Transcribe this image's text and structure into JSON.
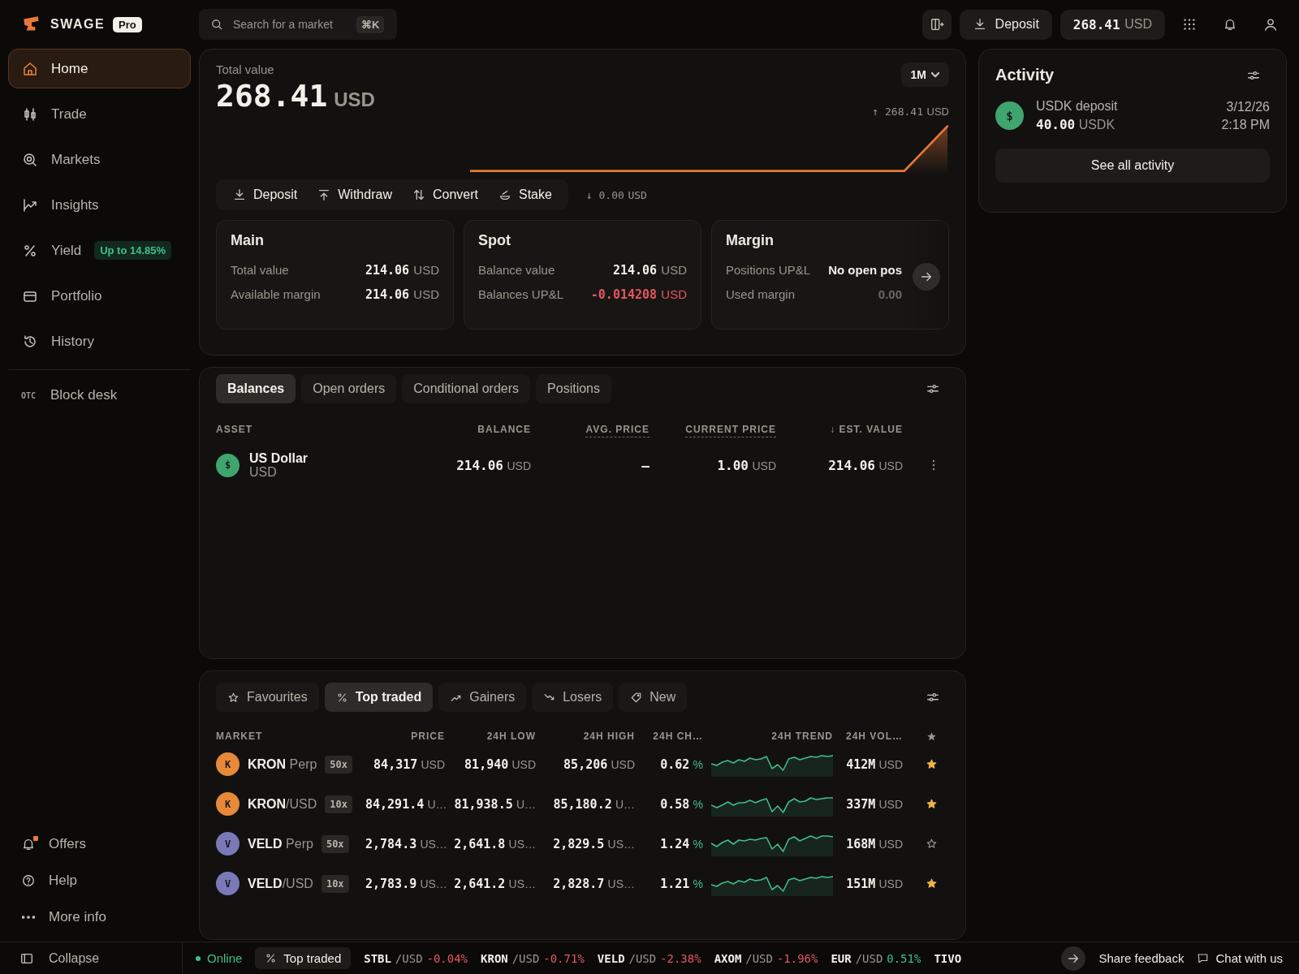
{
  "brand": {
    "name": "SWAGE",
    "badge": "Pro"
  },
  "sidebar": {
    "items": [
      {
        "label": "Home",
        "selected": true
      },
      {
        "label": "Trade",
        "selected": false
      },
      {
        "label": "Markets",
        "selected": false
      },
      {
        "label": "Insights",
        "selected": false
      },
      {
        "label": "Yield",
        "selected": false,
        "badge": "Up to 14.85%"
      },
      {
        "label": "Portfolio",
        "selected": false
      },
      {
        "label": "History",
        "selected": false
      }
    ],
    "otc": {
      "tag": "OTC",
      "label": "Block desk"
    },
    "bottom_items": [
      {
        "label": "Offers",
        "dot": true
      },
      {
        "label": "Help",
        "dot": false
      },
      {
        "label": "More info",
        "dot": false
      }
    ],
    "collapse": "Collapse"
  },
  "search": {
    "placeholder": "Search for a market",
    "shortcut": "⌘K"
  },
  "header": {
    "deposit": "Deposit",
    "balance": "268.41",
    "currency": "USD"
  },
  "overview": {
    "label": "Total value",
    "value": "268.41",
    "currency": "USD",
    "period": "1M",
    "high": "↑ 268.41",
    "high_currency": "USD",
    "low": "↓ 0.00",
    "low_currency": "USD",
    "actions": [
      "Deposit",
      "Withdraw",
      "Convert",
      "Stake"
    ],
    "accounts": [
      {
        "title": "Main",
        "rows": [
          {
            "label": "Total value",
            "value": "214.06",
            "unit": "USD",
            "negative": false
          },
          {
            "label": "Available margin",
            "value": "214.06",
            "unit": "USD",
            "negative": false
          }
        ]
      },
      {
        "title": "Spot",
        "rows": [
          {
            "label": "Balance value",
            "value": "214.06",
            "unit": "USD",
            "negative": false
          },
          {
            "label": "Balances UP&L",
            "value": "-0.014208",
            "unit": "USD",
            "negative": true
          }
        ]
      },
      {
        "title": "Margin",
        "rows": [
          {
            "label": "Positions UP&L",
            "value": "No open pos",
            "negative": false
          },
          {
            "label": "Used margin",
            "value": "0.00",
            "negative": false
          }
        ]
      }
    ]
  },
  "balances": {
    "tabs": [
      {
        "label": "Balances",
        "selected": true
      },
      {
        "label": "Open orders",
        "selected": false
      },
      {
        "label": "Conditional orders",
        "selected": false
      },
      {
        "label": "Positions",
        "selected": false
      }
    ],
    "columns": [
      "ASSET",
      "BALANCE",
      "AVG. PRICE",
      "CURRENT PRICE",
      "↓ EST. VALUE"
    ],
    "rows": [
      {
        "symbol": "$",
        "name": "US Dollar",
        "code": "USD",
        "balance": "214.06",
        "balance_unit": "USD",
        "avg_price": "–",
        "current_price": "1.00",
        "current_unit": "USD",
        "est_value": "214.06",
        "est_unit": "USD"
      }
    ]
  },
  "markets": {
    "tabs": [
      {
        "label": "Favourites",
        "selected": false
      },
      {
        "label": "Top traded",
        "selected": true
      },
      {
        "label": "Gainers",
        "selected": false
      },
      {
        "label": "Losers",
        "selected": false
      },
      {
        "label": "New",
        "selected": false
      }
    ],
    "columns": [
      "MARKET",
      "PRICE",
      "24H LOW",
      "24H HIGH",
      "24H CH…",
      "24H TREND",
      "24H VOL…"
    ],
    "rows": [
      {
        "letter": "K",
        "color": "#e8893a",
        "market": "**KRON** Perp",
        "leverage": "50x",
        "price": "84,317",
        "price_unit": "USD",
        "low": "81,940",
        "low_unit": "USD",
        "high": "85,206",
        "high_unit": "USD",
        "change": "0.62",
        "change_unit": "%",
        "volume": "412M",
        "volume_unit": "USD",
        "favourite": true
      },
      {
        "letter": "K",
        "color": "#e8893a",
        "market": "**KRON**/USD",
        "leverage": "10x",
        "price": "84,291.4",
        "price_unit": "U…",
        "low": "81,938.5",
        "low_unit": "U…",
        "high": "85,180.2",
        "high_unit": "U…",
        "change": "0.58",
        "change_unit": "%",
        "volume": "337M",
        "volume_unit": "USD",
        "favourite": true
      },
      {
        "letter": "V",
        "color": "#7b78b8",
        "market": "**VELD** Perp",
        "leverage": "50x",
        "price": "2,784.3",
        "price_unit": "US…",
        "low": "2,641.8",
        "low_unit": "US…",
        "high": "2,829.5",
        "high_unit": "US…",
        "change": "1.24",
        "change_unit": "%",
        "volume": "168M",
        "volume_unit": "USD",
        "favourite": false
      },
      {
        "letter": "V",
        "color": "#7b78b8",
        "market": "**VELD**/USD",
        "leverage": "10x",
        "price": "2,783.9",
        "price_unit": "US…",
        "low": "2,641.2",
        "low_unit": "US…",
        "high": "2,828.7",
        "high_unit": "US…",
        "change": "1.21",
        "change_unit": "%",
        "volume": "151M",
        "volume_unit": "USD",
        "favourite": true
      }
    ]
  },
  "activity": {
    "title": "Activity",
    "items": [
      {
        "symbol": "$",
        "title": "USDK deposit",
        "amount": "40.00",
        "unit": "USDK",
        "date": "3/12/26",
        "time": "2:18 PM"
      }
    ],
    "button": "See all activity"
  },
  "status_bar": {
    "status": "Online",
    "chip": "Top traded",
    "ticker": [
      {
        "symbol": "STBL",
        "pair": "/USD",
        "change": "-0.04%",
        "negative": true
      },
      {
        "symbol": "KRON",
        "pair": "/USD",
        "change": "-0.71%",
        "negative": true
      },
      {
        "symbol": "VELD",
        "pair": "/USD",
        "change": "-2.38%",
        "negative": true
      },
      {
        "symbol": "AXOM",
        "pair": "/USD",
        "change": "-1.96%",
        "negative": true
      },
      {
        "symbol": "EUR",
        "pair": "/USD",
        "change": "0.51%",
        "negative": false
      },
      {
        "symbol": "TIVO"
      }
    ],
    "feedback": "Share feedback",
    "chat": "Chat with us"
  }
}
